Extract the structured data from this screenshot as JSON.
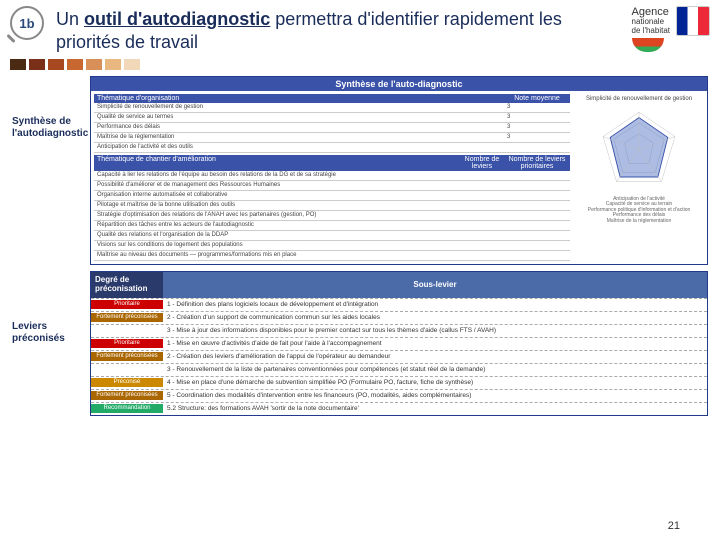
{
  "badge": "1b",
  "title_parts": {
    "prefix": "Un ",
    "bold_under": "outil d'autodiagnostic",
    "rest": " permettra d'identifier rapidement les priorités de travail"
  },
  "logo_right": {
    "line1": "Agence",
    "line2": "nationale",
    "line3": "de l'habitat"
  },
  "strip_colors": [
    "#4a2a12",
    "#7a3018",
    "#a84820",
    "#c86830",
    "#d89058",
    "#e8b880",
    "#f0d8b8"
  ],
  "side_label_1": "Synthèse de l'autodiagnostic",
  "side_label_2": "Leviers préconisés",
  "panel1": {
    "title": "Synthèse de l'auto-diagnostic",
    "subhead": {
      "c1": "Thématique d'organisation",
      "c2": "Note moyenne"
    },
    "rows": [
      {
        "c1": "Simplicité de renouvellement de gestion",
        "c2": "3"
      },
      {
        "c1": "Qualité de service au termes",
        "c2": "3"
      },
      {
        "c1": "Performance des délais",
        "c2": "3"
      },
      {
        "c1": "Maîtrise de la règlementation",
        "c2": "3"
      },
      {
        "c1": "Anticipation de l'activité et des outils",
        "c2": ""
      }
    ],
    "subhead2": {
      "c1": "Thématique de chantier d'amélioration",
      "c2": "Nombre de leviers",
      "c3": "Nombre de leviers prioritaires"
    },
    "rows2": [
      {
        "c1": "Capacité à lier les relations de l'équipe au besoin des relations de la DG et de sa stratégie"
      },
      {
        "c1": "Possibilité d'améliorer et de management des Ressources Humaines"
      },
      {
        "c1": "Organisation interne automatisée et collaborative"
      },
      {
        "c1": "Pilotage et maîtrise de la bonne utilisation des outils"
      },
      {
        "c1": "Stratégie d'optimisation des relations de l'ANAH avec les partenaires (gestion, PO)"
      },
      {
        "c1": "Répartition des tâches entre les acteurs de l'autodiagnostic"
      },
      {
        "c1": "Qualité des relations et l'organisation de la DDAP"
      },
      {
        "c1": "Visions sur les conditions de logement des populations"
      },
      {
        "c1": "Maîtrise au niveau des documents — programmes/formations mis en place"
      }
    ],
    "radar": {
      "title": "Simplicité de renouvellement de gestion",
      "axes": [
        "Anticipation de l'activité",
        "Capacité de service au terrain",
        "Performance politique d'information et d'action",
        "Performance des délais",
        "Maîtrise de la règlementation"
      ]
    }
  },
  "panel2": {
    "head1": "Degré de préconisation",
    "head2": "Sous-levier",
    "rows": [
      {
        "tag": "Prioritaire",
        "cls": "tag-p",
        "desc": "1 - Définition des plans logiciels locaux de développement et d'intégration"
      },
      {
        "tag": "Fortement préconisées",
        "cls": "tag-ftp",
        "desc": "2 - Création d'un support de communication commun sur les aides locales"
      },
      {
        "tag": "",
        "cls": "",
        "desc": "3 - Mise à jour des informations disponibles pour le premier contact sur tous les thèmes d'aide (callus FTS / AVAH)"
      },
      {
        "tag": "Prioritaire",
        "cls": "tag-p",
        "desc": "1 - Mise en œuvre d'activités d'aide de fait pour l'aide à l'accompagnement"
      },
      {
        "tag": "Fortement préconisées",
        "cls": "tag-ftp",
        "desc": "2 - Création des leviers d'amélioration de l'appui de l'opérateur au demandeur"
      },
      {
        "tag": "",
        "cls": "",
        "desc": "3 - Renouvellement de la liste de partenaires conventionnées pour compétences (et statut réel de la demande)"
      },
      {
        "tag": "Préconisé",
        "cls": "tag-pp",
        "desc": "4 - Mise en place d'une démarche de subvention simplifiée PO (Formulaire PO, facture, fiche de synthèse)"
      },
      {
        "tag": "Fortement préconisées",
        "cls": "tag-ftp",
        "desc": "5 - Coordination des modalités d'intervention entre les financeurs (PO, modalités, aides complémentaires)"
      },
      {
        "tag": "Recommandation",
        "cls": "tag-rcp",
        "desc": "5.2 Structure: des formations AVAH 'sortir de la note documentaire'"
      }
    ]
  },
  "chart_data": {
    "type": "radar",
    "title": "Simplicité de renouvellement de gestion",
    "axes": [
      "Anticipation de l'activité",
      "Capacité de service au terrain",
      "Performance politique d'information et d'action",
      "Performance des délais",
      "Maîtrise de la règlementation"
    ],
    "series": [
      {
        "name": "Note moyenne",
        "values": [
          3,
          3,
          3,
          3,
          3
        ],
        "scale_max": 5
      }
    ]
  },
  "page_number": "21"
}
